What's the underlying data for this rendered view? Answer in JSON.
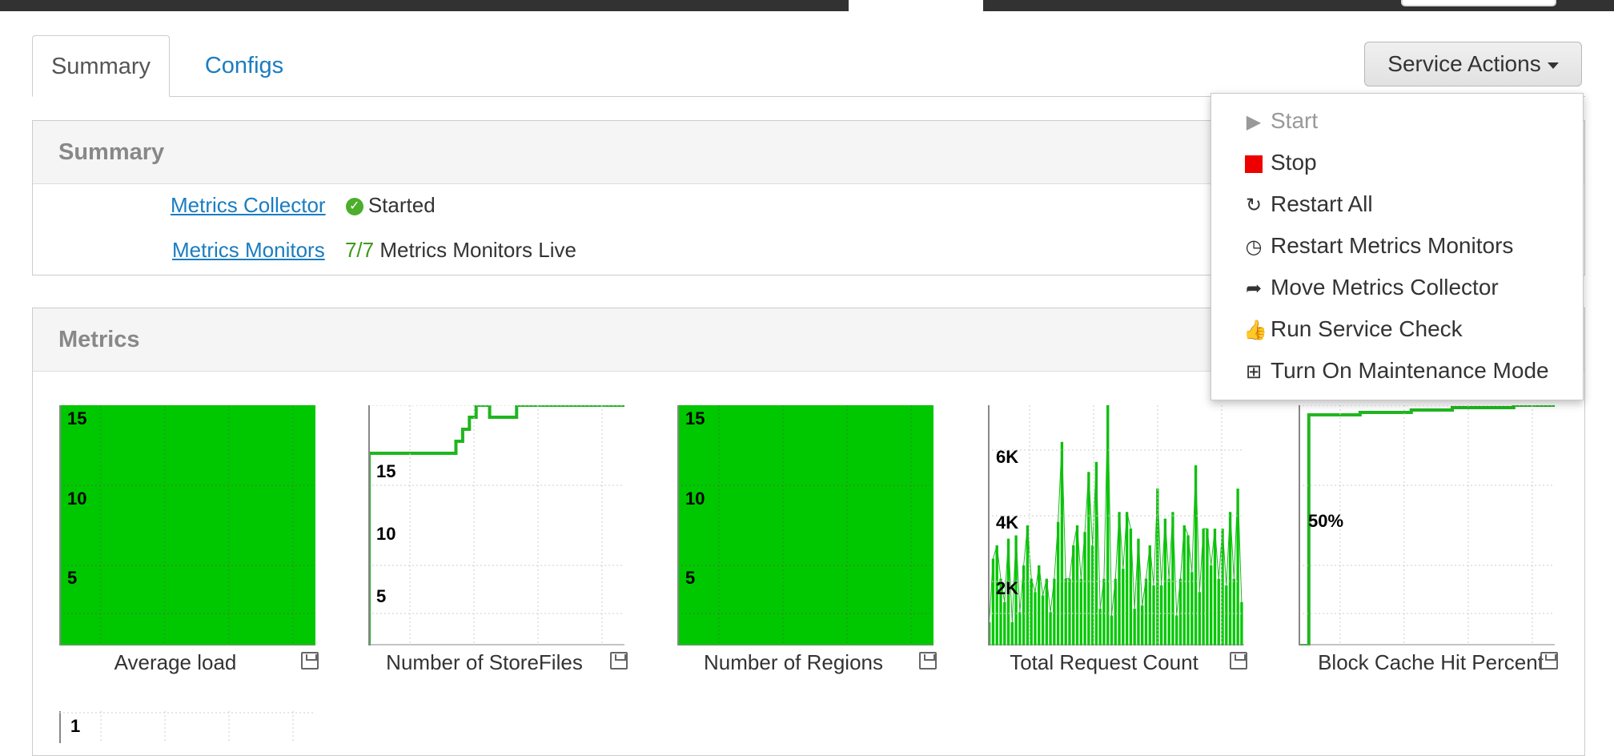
{
  "tabs": [
    {
      "label": "Summary",
      "active": true
    },
    {
      "label": "Configs",
      "active": false
    }
  ],
  "service_actions": {
    "label": "Service Actions"
  },
  "summary": {
    "title": "Summary",
    "collector": {
      "name": "Metrics Collector",
      "status": "Started"
    },
    "monitors": {
      "name": "Metrics Monitors",
      "count": "7/7",
      "suffix": "Metrics Monitors Live"
    }
  },
  "metrics": {
    "title": "Metrics"
  },
  "menu": {
    "items": [
      {
        "label": "Start",
        "icon": "play-icon",
        "enabled": false
      },
      {
        "label": "Stop",
        "icon": "stop-icon",
        "enabled": true
      },
      {
        "label": "Restart All",
        "icon": "refresh-icon",
        "enabled": true
      },
      {
        "label": "Restart Metrics Monitors",
        "icon": "clock-icon",
        "enabled": true
      },
      {
        "label": "Move Metrics Collector",
        "icon": "share-icon",
        "enabled": true
      },
      {
        "label": "Run Service Check",
        "icon": "thumbs-up-icon",
        "enabled": true
      },
      {
        "label": "Turn On Maintenance Mode",
        "icon": "medkit-icon",
        "enabled": true
      }
    ]
  },
  "colors": {
    "fill": "#00c800",
    "line": "#1fb61f",
    "link": "#1a7dc0",
    "stop": "#e00000"
  },
  "chart_data": [
    {
      "type": "area",
      "title": "Average load",
      "yticks": [
        "15",
        "10",
        "5"
      ],
      "ylim": [
        0,
        15
      ],
      "series": [
        {
          "values": [
            15,
            15,
            15,
            15,
            15,
            15,
            15,
            15,
            15,
            15,
            15,
            15
          ]
        }
      ]
    },
    {
      "type": "line",
      "title": "Number of StoreFiles",
      "yticks": [
        "15",
        "10",
        "5"
      ],
      "ylim": [
        0,
        20
      ],
      "series": [
        {
          "values": [
            16,
            16,
            16,
            16,
            16,
            16,
            16,
            16,
            16,
            16,
            16,
            16,
            16,
            17,
            18,
            19,
            20,
            20,
            19,
            19,
            19,
            19,
            20,
            20,
            20,
            20,
            20,
            20,
            20,
            20,
            20,
            20,
            20,
            20,
            20,
            20,
            20,
            20,
            20
          ]
        }
      ]
    },
    {
      "type": "area",
      "title": "Number of Regions",
      "yticks": [
        "15",
        "10",
        "5"
      ],
      "ylim": [
        0,
        15
      ],
      "series": [
        {
          "values": [
            15,
            15,
            15,
            15,
            15,
            15,
            15,
            15,
            15,
            15,
            15,
            15
          ]
        }
      ]
    },
    {
      "type": "bar",
      "title": "Total Request Count",
      "yticks": [
        "6K",
        "4K",
        "2K"
      ],
      "ylim": [
        0,
        7200
      ],
      "series": [
        {
          "values": [
            700,
            2600,
            3000,
            2000,
            1300,
            3200,
            700,
            3300,
            1000,
            2400,
            3600,
            2000,
            1600,
            2400,
            1500,
            2000,
            1000,
            2000,
            3700,
            6100,
            2000,
            2000,
            3000,
            3600,
            2000,
            3400,
            5200,
            3000,
            5500,
            1100,
            2000,
            7200,
            900,
            2000,
            4000,
            2300,
            4000,
            3500,
            1100,
            3200,
            1200,
            2000,
            3000,
            1800,
            4700,
            1800,
            3800,
            2000,
            4000,
            900,
            2000,
            3600,
            3300,
            2200,
            5400,
            1600,
            3500,
            3500,
            2400,
            3500,
            2000,
            3500,
            1800,
            4000,
            2000,
            4700,
            1300
          ]
        }
      ]
    },
    {
      "type": "line",
      "title": "Block Cache Hit Percent",
      "yticks": [
        "50%"
      ],
      "ylim": [
        0,
        100
      ],
      "series": [
        {
          "values": [
            0,
            96,
            96,
            96,
            96,
            96,
            97,
            97,
            97,
            97,
            97,
            98,
            98,
            98,
            98,
            99,
            99,
            99,
            99,
            99,
            99,
            100,
            100,
            100,
            100,
            100
          ]
        }
      ]
    }
  ],
  "extra_chart": {
    "ytick": "1"
  }
}
